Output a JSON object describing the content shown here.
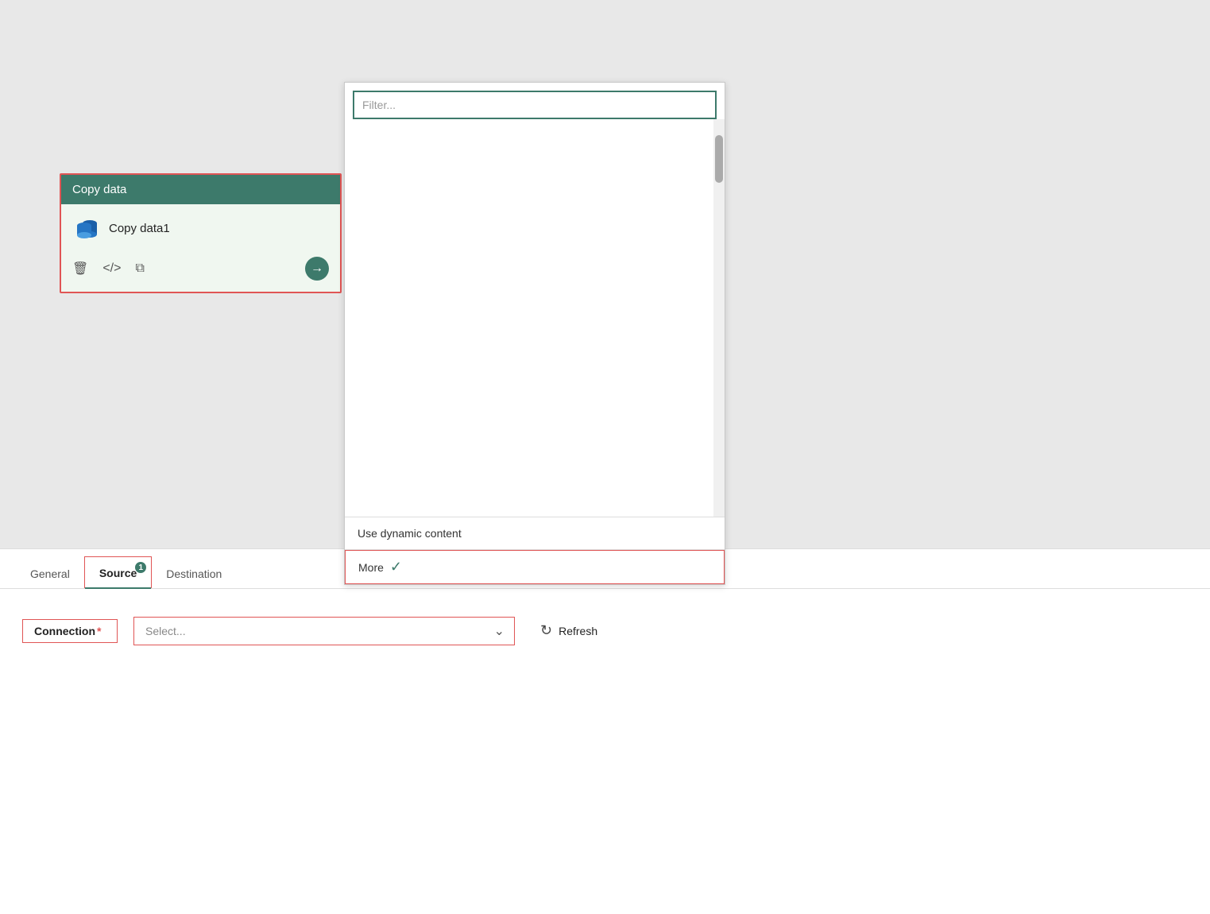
{
  "canvas": {
    "background": "#e8e8e8"
  },
  "copy_data_card": {
    "header": "Copy data",
    "item_name": "Copy data1",
    "actions": {
      "delete_label": "delete-icon",
      "code_label": "code-icon",
      "copy_label": "copy-icon",
      "go_label": "arrow-right-icon"
    }
  },
  "dropdown_panel": {
    "filter_placeholder": "Filter...",
    "items": [],
    "footer": {
      "dynamic_content_label": "Use dynamic content",
      "more_label": "More"
    }
  },
  "tabs": {
    "items": [
      {
        "label": "General",
        "active": false,
        "badge": null
      },
      {
        "label": "Source",
        "active": true,
        "badge": "1"
      },
      {
        "label": "Destination",
        "active": false,
        "badge": null
      }
    ]
  },
  "form": {
    "connection_label": "Connection",
    "required_star": "*",
    "select_placeholder": "Select...",
    "refresh_label": "Refresh"
  }
}
